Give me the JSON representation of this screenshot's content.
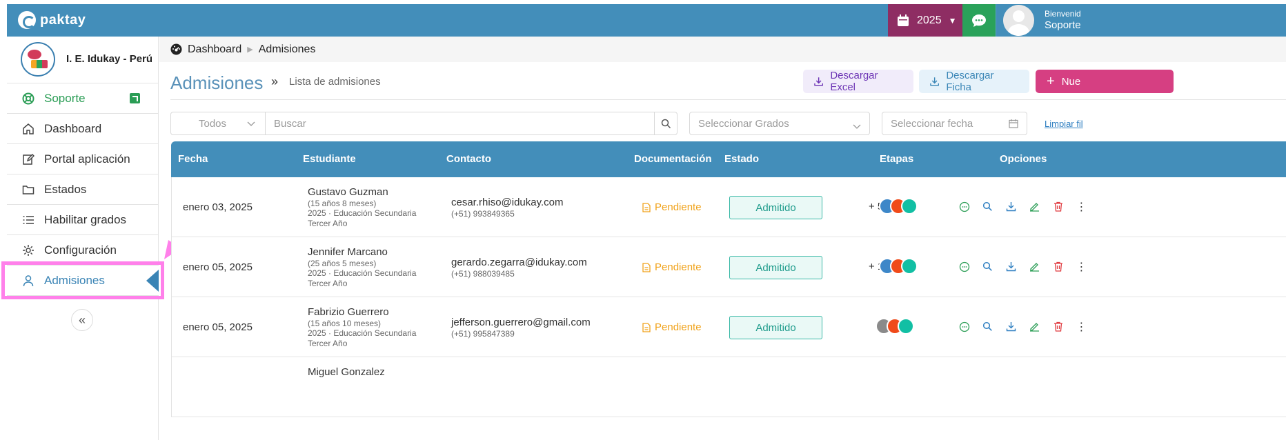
{
  "header": {
    "logo_text": "paktay",
    "year": "2025",
    "user_greeting": "Bienvenid",
    "user_name": "Soporte"
  },
  "sidebar": {
    "school_name": "I. E. Idukay - Perú",
    "items": [
      {
        "label": "Soporte",
        "icon": "lifebuoy-icon"
      },
      {
        "label": "Dashboard",
        "icon": "home-icon"
      },
      {
        "label": "Portal aplicación",
        "icon": "edit-icon"
      },
      {
        "label": "Estados",
        "icon": "folder-icon"
      },
      {
        "label": "Habilitar grados",
        "icon": "list-icon"
      },
      {
        "label": "Configuración",
        "icon": "gear-icon"
      },
      {
        "label": "Admisiones",
        "icon": "user-icon"
      }
    ],
    "collapse_glyph": "«"
  },
  "breadcrumb": {
    "items": [
      "Dashboard",
      "Admisiones"
    ]
  },
  "page": {
    "title": "Admisiones",
    "sep": "»",
    "subtitle": "Lista de admisiones",
    "btn_excel": "Descargar Excel",
    "btn_ficha": "Descargar Ficha",
    "btn_new": "Nue"
  },
  "filters": {
    "status_value": "Todos",
    "search_placeholder": "Buscar",
    "grades_placeholder": "Seleccionar Grados",
    "date_placeholder": "Seleccionar fecha",
    "clear_label": "Limpiar fil"
  },
  "table": {
    "headers": [
      "Fecha",
      "Estudiante",
      "Contacto",
      "Documentación",
      "Estado",
      "Etapas",
      "Opciones"
    ],
    "rows": [
      {
        "date": "enero 03, 2025",
        "name": "Gustavo Guzman",
        "age": "(15 años 8 meses)",
        "level": "2025 · Educación Secundaria",
        "grade": "Tercer Año",
        "email": "cesar.rhiso@idukay.com",
        "phone": "(+51) 993849365",
        "doc": "Pendiente",
        "status": "Admitido",
        "extra": "+ 5",
        "dots": [
          "#3d87c8",
          "#f04a1a",
          "#12bfa4"
        ]
      },
      {
        "date": "enero 05, 2025",
        "name": "Jennifer Marcano",
        "age": "(25 años 5 meses)",
        "level": "2025 · Educación Secundaria",
        "grade": "Tercer Año",
        "email": "gerardo.zegarra@idukay.com",
        "phone": "(+51) 988039485",
        "doc": "Pendiente",
        "status": "Admitido",
        "extra": "+ 1",
        "dots": [
          "#3d87c8",
          "#f04a1a",
          "#12bfa4"
        ]
      },
      {
        "date": "enero 05, 2025",
        "name": "Fabrizio Guerrero",
        "age": "(15 años 10 meses)",
        "level": "2025 · Educación Secundaria",
        "grade": "Tercer Año",
        "email": "jefferson.guerrero@gmail.com",
        "phone": "(+51) 995847389",
        "doc": "Pendiente",
        "status": "Admitido",
        "extra": "",
        "dots": [
          "#8a8a8a",
          "#f04a1a",
          "#12bfa4"
        ]
      },
      {
        "name": "Miguel Gonzalez"
      }
    ]
  }
}
